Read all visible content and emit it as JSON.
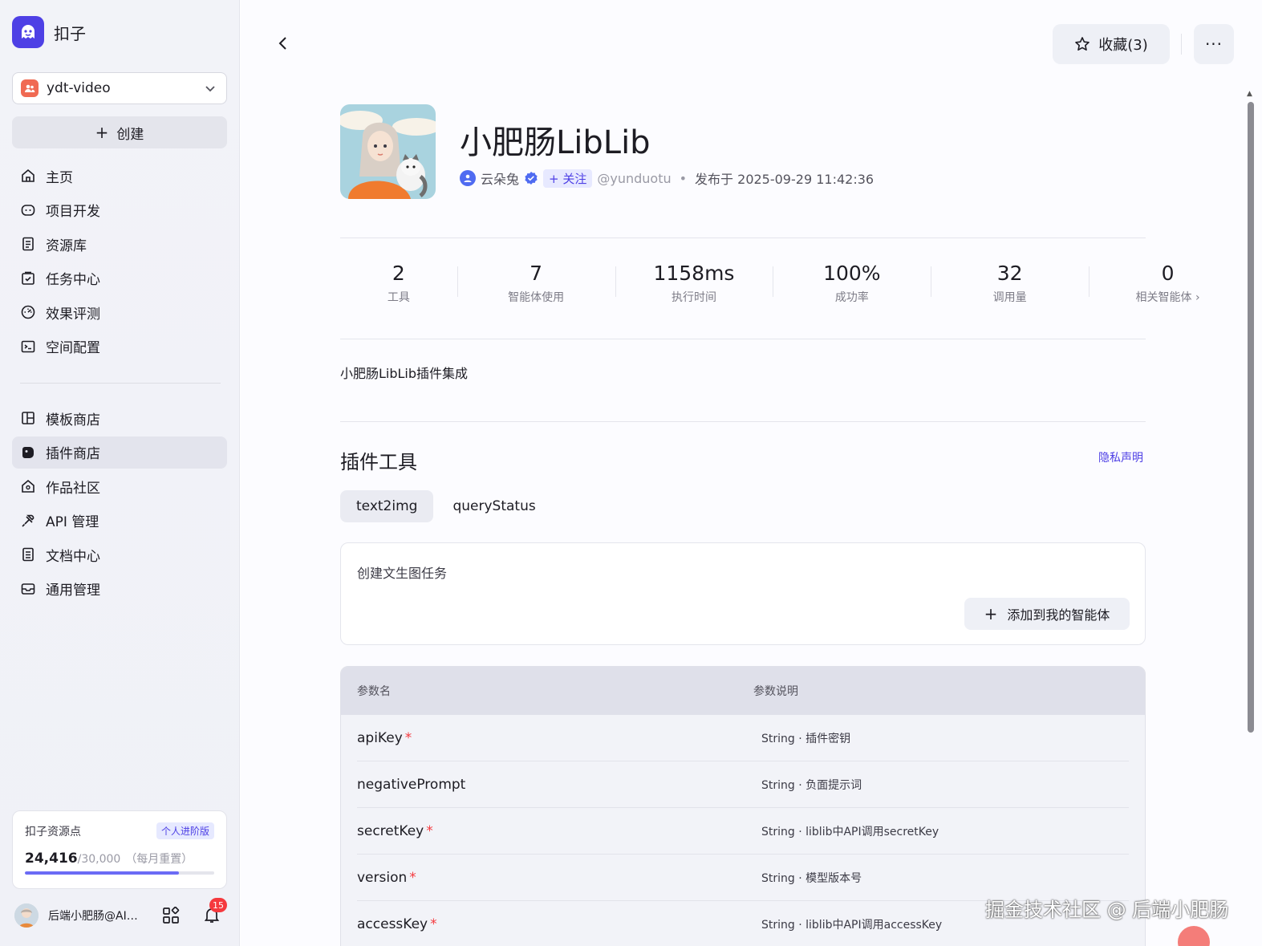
{
  "brand": {
    "name": "扣子"
  },
  "workspace": {
    "name": "ydt-video"
  },
  "sidebar": {
    "create_label": "创建",
    "items": [
      {
        "label": "主页",
        "icon": "home-icon"
      },
      {
        "label": "项目开发",
        "icon": "robot-icon"
      },
      {
        "label": "资源库",
        "icon": "library-icon"
      },
      {
        "label": "任务中心",
        "icon": "task-icon"
      },
      {
        "label": "效果评测",
        "icon": "gauge-icon"
      },
      {
        "label": "空间配置",
        "icon": "terminal-icon"
      },
      {
        "label": "模板商店",
        "icon": "template-icon"
      },
      {
        "label": "插件商店",
        "icon": "plugin-icon",
        "active": true
      },
      {
        "label": "作品社区",
        "icon": "community-icon"
      },
      {
        "label": "API 管理",
        "icon": "api-icon"
      },
      {
        "label": "文档中心",
        "icon": "doc-icon"
      },
      {
        "label": "通用管理",
        "icon": "inbox-icon"
      }
    ],
    "credits": {
      "title": "扣子资源点",
      "plan": "个人进阶版",
      "used": "24,416",
      "total": "/30,000",
      "reset": "（每月重置）",
      "progress": 0.814
    },
    "user": {
      "name": "后端小肥肠@AI…",
      "notifications": "15"
    }
  },
  "header": {
    "favorite_label": "收藏(3)",
    "more_label": "···"
  },
  "plugin": {
    "title": "小肥肠LibLib",
    "author": "云朵兔",
    "follow_label": "+ 关注",
    "handle": "@yunduotu",
    "published": "发布于 2025-09-29 11:42:36",
    "description": "小肥肠LibLib插件集成"
  },
  "stats": [
    {
      "value": "2",
      "label": "工具"
    },
    {
      "value": "7",
      "label": "智能体使用"
    },
    {
      "value": "1158ms",
      "label": "执行时间"
    },
    {
      "value": "100%",
      "label": "成功率"
    },
    {
      "value": "32",
      "label": "调用量"
    },
    {
      "value": "0",
      "label": "相关智能体"
    }
  ],
  "tools": {
    "section_title": "插件工具",
    "privacy_label": "隐私声明",
    "tabs": [
      "text2img",
      "queryStatus"
    ],
    "active_tab": 0,
    "card": {
      "description": "创建文生图任务",
      "add_label": "添加到我的智能体"
    },
    "params_header": {
      "name": "参数名",
      "desc": "参数说明"
    },
    "params": [
      {
        "name": "apiKey",
        "required": true,
        "desc": "String · 插件密钥"
      },
      {
        "name": "negativePrompt",
        "required": false,
        "desc": "String · 负面提示词"
      },
      {
        "name": "secretKey",
        "required": true,
        "desc": "String · liblib中API调用secretKey"
      },
      {
        "name": "version",
        "required": true,
        "desc": "String · 模型版本号"
      },
      {
        "name": "accessKey",
        "required": true,
        "desc": "String · liblib中API调用accessKey"
      }
    ]
  },
  "watermark": "掘金技术社区 @ 后端小肥肠",
  "colors": {
    "accent": "#4e40e5",
    "required": "#f5393e",
    "badge": "#f5393e"
  }
}
